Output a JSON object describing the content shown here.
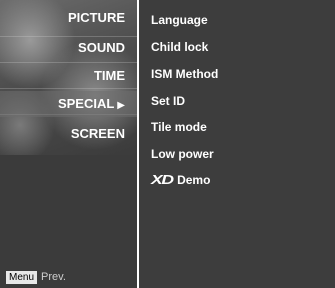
{
  "left_menu": {
    "items": [
      {
        "label": "PICTURE",
        "selected": false
      },
      {
        "label": "SOUND",
        "selected": false
      },
      {
        "label": "TIME",
        "selected": false
      },
      {
        "label": "SPECIAL",
        "selected": true,
        "arrow": "▶"
      },
      {
        "label": "SCREEN",
        "selected": false
      }
    ],
    "footer": {
      "menu_key": "Menu",
      "prev_label": "Prev."
    }
  },
  "submenu": {
    "items": [
      {
        "label": "Language"
      },
      {
        "label": "Child lock"
      },
      {
        "label": "ISM Method"
      },
      {
        "label": "Set ID"
      },
      {
        "label": "Tile mode"
      },
      {
        "label": "Low power"
      },
      {
        "logo": "XD",
        "label": "Demo"
      }
    ]
  }
}
